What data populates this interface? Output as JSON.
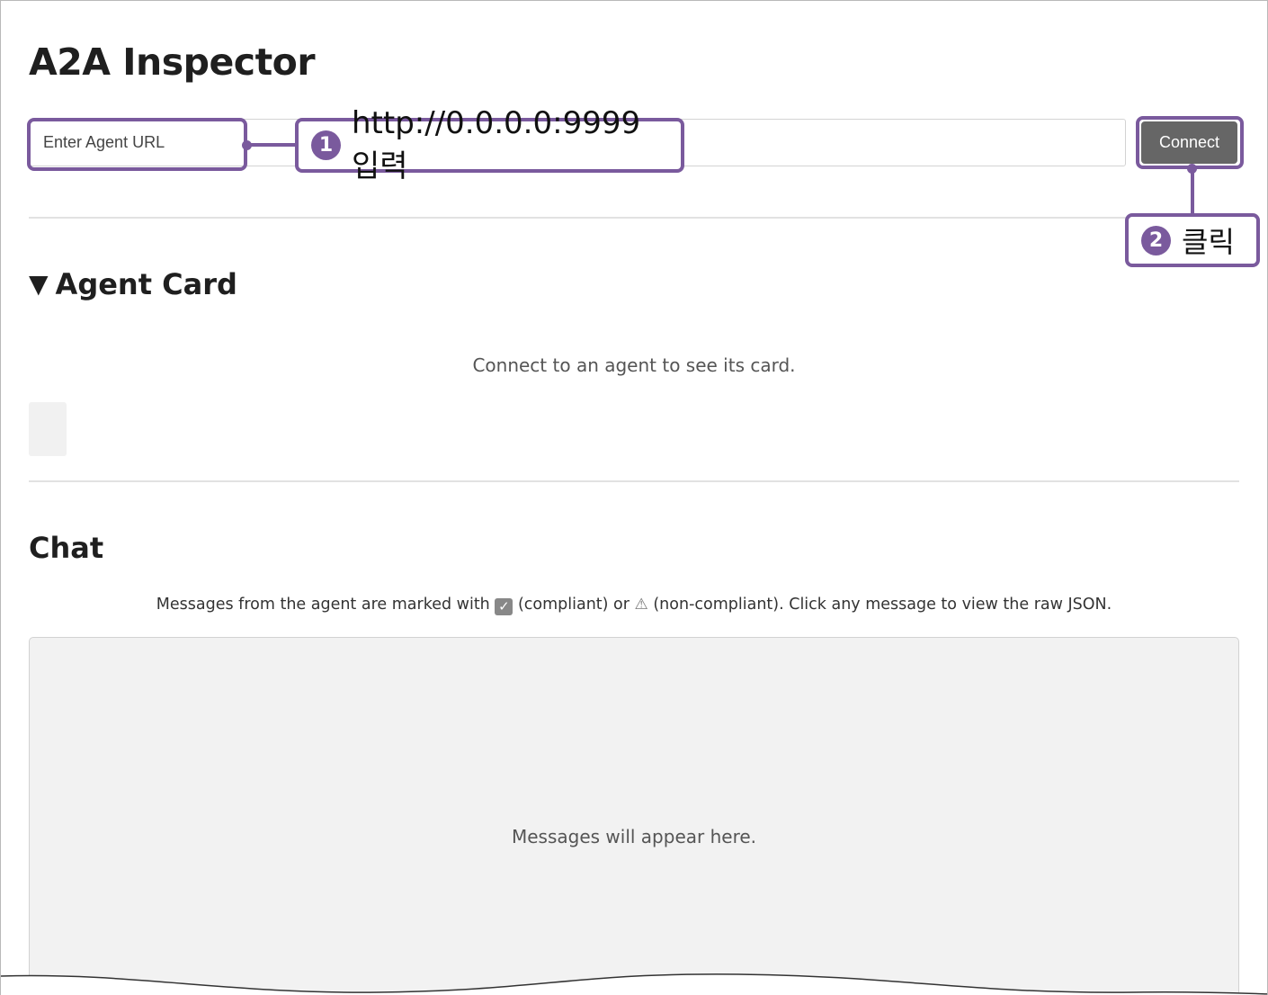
{
  "app": {
    "title": "A2A Inspector"
  },
  "connection": {
    "url_placeholder": "Enter Agent URL",
    "url_value": "",
    "connect_label": "Connect"
  },
  "agent_card": {
    "toggle_glyph": "▼",
    "title": "Agent Card",
    "empty_text": "Connect to an agent to see its card."
  },
  "chat": {
    "title": "Chat",
    "hint_prefix": "Messages from the agent are marked with",
    "hint_compliant": "(compliant) or",
    "hint_suffix": "(non-compliant). Click any message to view the raw JSON.",
    "empty_text": "Messages will appear here."
  },
  "annotations": {
    "step1_number": "1",
    "step1_text": "http://0.0.0.0:9999 입력",
    "step2_number": "2",
    "step2_text": "클릭",
    "color": "#7a5a9d"
  },
  "icons": {
    "compliant": "checkbox-check-icon",
    "non_compliant": "warning-triangle-icon",
    "collapse": "triangle-down-icon"
  }
}
